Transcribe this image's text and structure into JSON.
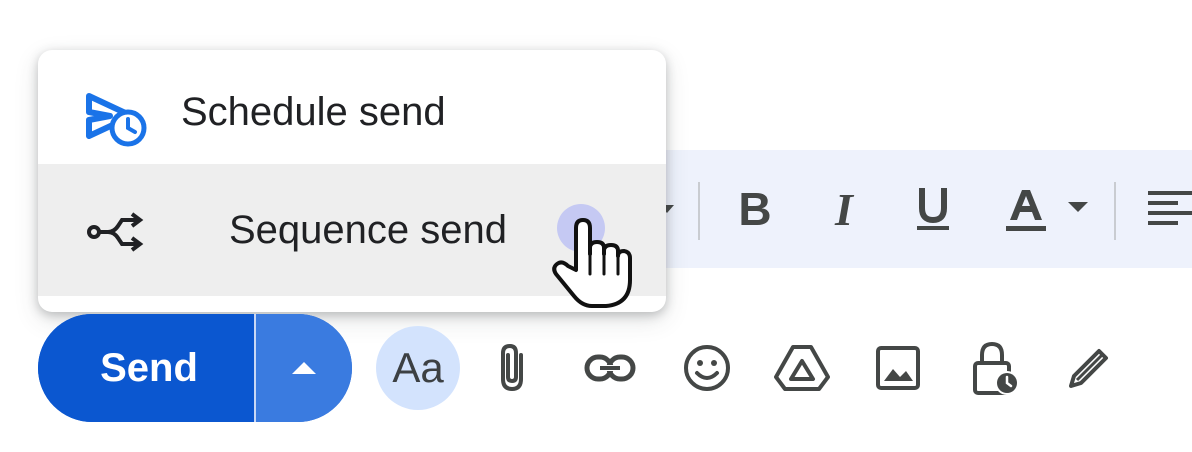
{
  "menu": {
    "items": [
      {
        "label": "Schedule send",
        "icon": "schedule-send-icon"
      },
      {
        "label": "Sequence send",
        "icon": "sequence-send-icon"
      }
    ]
  },
  "compose": {
    "send_label": "Send",
    "more_options_icon": "arrow-up-icon",
    "formatting_label": "Aa"
  },
  "toolbar_icons": [
    "attach-icon",
    "link-icon",
    "emoji-icon",
    "drive-icon",
    "photo-icon",
    "confidential-icon",
    "signature-icon"
  ],
  "format_icons": [
    "bold-icon",
    "italic-icon",
    "underline-icon",
    "text-color-icon",
    "align-icon"
  ],
  "format_glyphs": {
    "bold": "B",
    "italic": "I",
    "underline": "U",
    "text_color": "A"
  },
  "colors": {
    "accent": "#0b57d0",
    "send_more": "#3a7be0",
    "icon_blue": "#1a73e8",
    "hover_bg": "#eeeeee",
    "toolbar_bg": "#eef2fc"
  }
}
